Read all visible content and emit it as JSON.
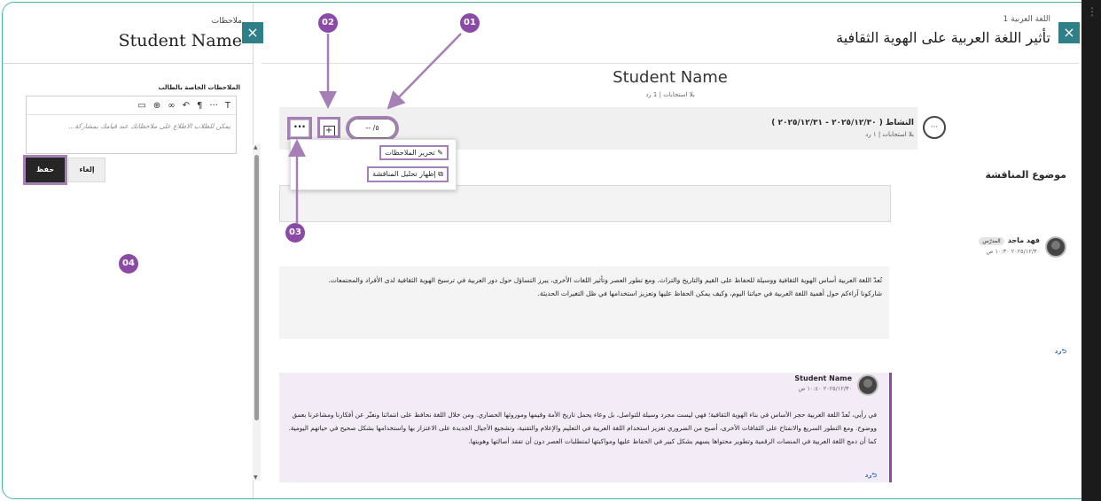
{
  "notes_panel": {
    "subtitle": "ملاحظات",
    "title": "Student Name",
    "close_label": "×",
    "label": "الملاحظات الخاصة بالطالب",
    "toolbar": [
      "T",
      "···",
      "¶",
      "↵",
      "⊕",
      "⊞"
    ],
    "placeholder": "يمكن للطلاب الاطلاع على ملاحظاتك عند قيامك بمشاركة...",
    "cancel_label": "إلغاء",
    "save_label": "حفظ"
  },
  "main": {
    "close_label": "×",
    "course": "اللغة العربية 1",
    "title": "تأثير اللغة العربية على الهوية الثقافية",
    "student_name": "Student Name",
    "student_stats": "بلا استجابات | 1 رد",
    "activity": {
      "title": "النشاط ( ٢٠٢٥/١٢/٣٠ - ٢٠٢٥/١٢/٣١ )",
      "stats": "بلا استجابات | ١ رد",
      "grade": "-- /٥",
      "more_label": "···"
    },
    "menu": {
      "edit_notes": "تحرير الملاحظات",
      "show_analysis": "إظهار تحليل المناقشة"
    },
    "topic_label": "موضوع المناقشة",
    "post": {
      "author": "فهد ماجد",
      "role": "المدرّس",
      "time": "٢٠٢٥/١٢/٣٠ ١٠:٣٠ ص",
      "paragraph1": "تُعدّ اللغة العربية أساس الهوية الثقافية ووسيلة للحفاظ على القيم والتاريخ والتراث. ومع تطور العصر وتأثير اللغات الأخرى، يبرز التساؤل حول دور العربية في ترسيخ الهوية الثقافية لدى الأفراد والمجتمعات.",
      "paragraph2": "شاركونا آراءكم حول أهمية اللغة العربية في حياتنا اليوم، وكيف يمكن الحفاظ عليها وتعزيز استخدامها في ظل التغيرات الحديثة.",
      "reply_label": "رد"
    },
    "response": {
      "author": "Student Name",
      "time": "٢٠٢٥/١٢/٣٠ ١٠:٤٠ ص",
      "body": "في رأيي، تُعدّ اللغة العربية حجر الأساس في بناء الهوية الثقافية؛ فهي ليست مجرد وسيلة للتواصل، بل وعاء يحمل تاريخ الأمة وقيمها وموروثها الحضاري. ومن خلال اللغة نحافظ على انتمائنا ونعبّر عن أفكارنا ومشاعرنا بعمق ووضوح. ومع التطور السريع والانفتاح على الثقافات الأخرى، أصبح من الضروري تعزيز استخدام اللغة العربية في التعليم والإعلام والتقنية، وتشجيع الأجيال الجديدة على الاعتزاز بها واستخدامها بشكل صحيح في حياتهم اليومية. كما أن دمج اللغة العربية في المنصات الرقمية وتطوير محتواها يسهم بشكل كبير في الحفاظ عليها ومواكبتها لمتطلبات العصر دون أن تفقد أصالتها وهويتها.",
      "reply_label": "رد"
    }
  },
  "callouts": [
    "01",
    "02",
    "03",
    "04"
  ],
  "colors": {
    "accent": "#8b4aa6",
    "close_button": "#2f7f89",
    "frame": "#3fb7a4"
  }
}
